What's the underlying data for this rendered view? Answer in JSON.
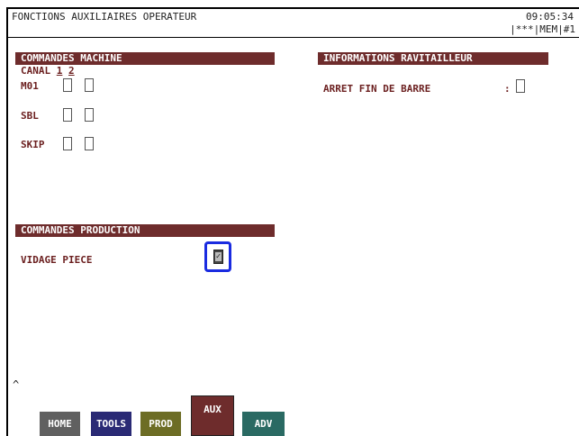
{
  "header": {
    "title": "FONCTIONS AUXILIAIRES OPERATEUR",
    "time": "09:05:34",
    "mode_status": "|***|MEM|#1"
  },
  "machine_commands": {
    "title": "COMMANDES MACHINE",
    "canal_label": "CANAL",
    "channel_1": "1",
    "channel_2": "2",
    "rows": [
      {
        "label": "M01"
      },
      {
        "label": "SBL"
      },
      {
        "label": "SKIP"
      }
    ]
  },
  "supplier_info": {
    "title": "INFORMATIONS RAVITAILLEUR",
    "row_label": "ARRET FIN DE BARRE",
    "row_colon": ":"
  },
  "production_commands": {
    "title": "COMMANDES PRODUCTION",
    "row_label": "VIDAGE PIECE"
  },
  "caret": "^",
  "tabs": {
    "home": "HOME",
    "tools": "TOOLS",
    "prod": "PROD",
    "aux": "AUX",
    "adv": "ADV"
  },
  "colors": {
    "section_bg": "#6e2c2c",
    "label_text": "#6b1f1f",
    "selection_border": "#1a2be0"
  }
}
